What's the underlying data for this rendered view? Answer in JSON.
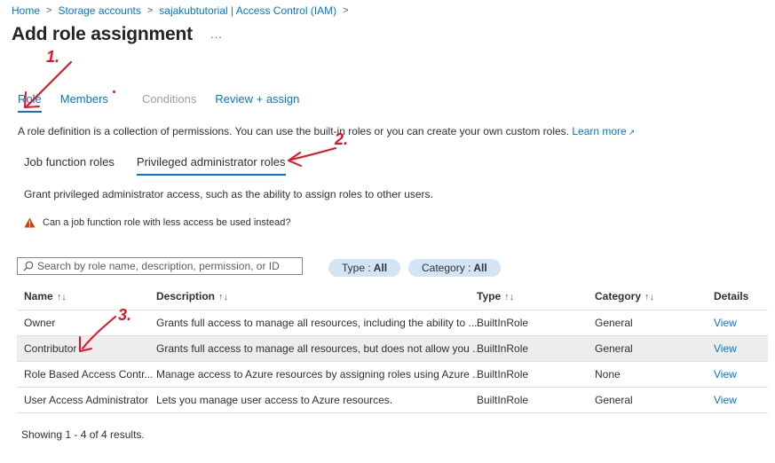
{
  "breadcrumb": {
    "items": [
      "Home",
      "Storage accounts",
      "sajakubtutorial | Access Control (IAM)"
    ]
  },
  "page": {
    "title": "Add role assignment",
    "more": "..."
  },
  "tabs": [
    {
      "label": "Role"
    },
    {
      "label": "Members"
    },
    {
      "label": "Conditions"
    },
    {
      "label": "Review + assign"
    }
  ],
  "description": {
    "text": "A role definition is a collection of permissions. You can use the built-in roles or you can create your own custom roles.",
    "link": "Learn more"
  },
  "subtabs": [
    {
      "label": "Job function roles"
    },
    {
      "label": "Privileged administrator roles"
    }
  ],
  "grant_text": "Grant privileged administrator access, such as the ability to assign roles to other users.",
  "warning_text": "Can a job function role with less access be used instead?",
  "search": {
    "placeholder": "Search by role name, description, permission, or ID",
    "value": ""
  },
  "filters": {
    "type": {
      "label": "Type :",
      "value": "All"
    },
    "category": {
      "label": "Category :",
      "value": "All"
    }
  },
  "table": {
    "headers": [
      "Name",
      "Description",
      "Type",
      "Category",
      "Details"
    ],
    "rows": [
      {
        "name": "Owner",
        "description": "Grants full access to manage all resources, including the ability to ...",
        "type": "BuiltInRole",
        "category": "General",
        "details": "View"
      },
      {
        "name": "Contributor",
        "description": "Grants full access to manage all resources, but does not allow you ...",
        "type": "BuiltInRole",
        "category": "General",
        "details": "View"
      },
      {
        "name": "Role Based Access Contr...",
        "description": "Manage access to Azure resources by assigning roles using Azure ...",
        "type": "BuiltInRole",
        "category": "None",
        "details": "View"
      },
      {
        "name": "User Access Administrator",
        "description": "Lets you manage user access to Azure resources.",
        "type": "BuiltInRole",
        "category": "General",
        "details": "View"
      }
    ],
    "selected_row": 1
  },
  "results_text": "Showing 1 - 4 of 4 results.",
  "annotations": [
    "1.",
    "2.",
    "3."
  ],
  "colors": {
    "accent": "#0078d4",
    "annotation": "#e81123",
    "warning": "#d83b01",
    "pill": "#d3e4f5"
  },
  "icons": [
    "chevron-right-icon",
    "more-icon",
    "external-link-icon",
    "warning-icon",
    "search-icon",
    "sort-icon"
  ]
}
